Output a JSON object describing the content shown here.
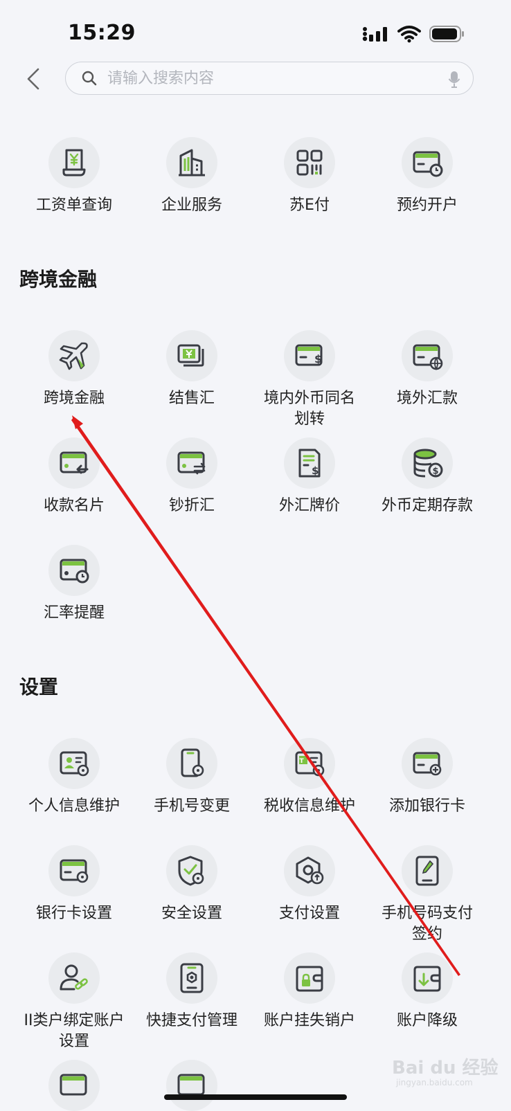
{
  "status": {
    "time": "15:29"
  },
  "search": {
    "placeholder": "请输入搜索内容"
  },
  "top_items": [
    {
      "label": "工资单查询",
      "icon": "payslip-icon"
    },
    {
      "label": "企业服务",
      "icon": "building-icon"
    },
    {
      "label": "苏E付",
      "icon": "qr-pay-icon"
    },
    {
      "label": "预约开户",
      "icon": "card-clock-icon"
    }
  ],
  "cross_border": {
    "title": "跨境金融",
    "items": [
      {
        "label": "跨境金融",
        "icon": "airplane-icon"
      },
      {
        "label": "结售汇",
        "icon": "yuan-note-icon"
      },
      {
        "label": "境内外币同名",
        "label2": "划转",
        "icon": "card-dollar-icon"
      },
      {
        "label": "境外汇款",
        "icon": "card-globe-icon"
      },
      {
        "label": "收款名片",
        "icon": "card-arrow-left-icon"
      },
      {
        "label": "钞折汇",
        "icon": "card-exchange-icon"
      },
      {
        "label": "外汇牌价",
        "icon": "doc-dollar-icon"
      },
      {
        "label": "外币定期存款",
        "icon": "coins-dollar-icon"
      },
      {
        "label": "汇率提醒",
        "icon": "card-clock-icon"
      }
    ]
  },
  "settings": {
    "title": "设置",
    "items": [
      {
        "label": "个人信息维护",
        "icon": "id-card-gear-icon"
      },
      {
        "label": "手机号变更",
        "icon": "phone-gear-icon"
      },
      {
        "label": "税收信息维护",
        "icon": "tax-gear-icon"
      },
      {
        "label": "添加银行卡",
        "icon": "card-plus-icon"
      },
      {
        "label": "银行卡设置",
        "icon": "card-gear-icon"
      },
      {
        "label": "安全设置",
        "icon": "shield-gear-icon"
      },
      {
        "label": "支付设置",
        "icon": "hexagon-gear-icon"
      },
      {
        "label": "手机号码支付",
        "label2": "签约",
        "icon": "tablet-pen-icon"
      },
      {
        "label": "II类户绑定账户",
        "label2": "设置",
        "icon": "user-link-icon"
      },
      {
        "label": "快捷支付管理",
        "icon": "tablet-gear-icon"
      },
      {
        "label": "账户挂失销户",
        "icon": "wallet-lock-icon"
      },
      {
        "label": "账户降级",
        "icon": "wallet-down-icon"
      }
    ]
  },
  "watermark": {
    "text": "Bai du 经验",
    "sub": "jingyan.baidu.com"
  },
  "colors": {
    "accent": "#7cc242",
    "icon_stroke": "#3a3d44",
    "arrow": "#e01c1c"
  }
}
